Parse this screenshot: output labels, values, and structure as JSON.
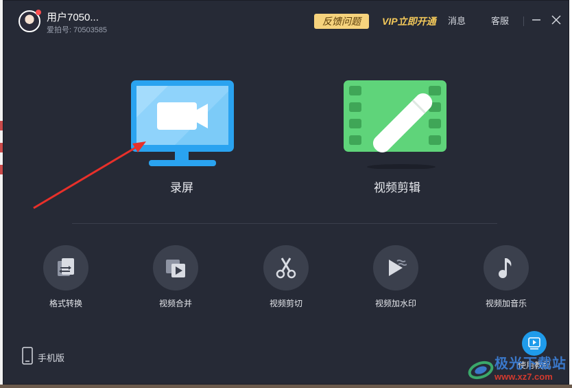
{
  "header": {
    "username": "用户7050...",
    "user_id": "爱拍号: 70503585",
    "feedback_label": "反馈问题",
    "vip_label": "VIP立即开通",
    "messages_label": "消息",
    "service_label": "客服"
  },
  "features": {
    "record_label": "录屏",
    "edit_label": "视频剪辑"
  },
  "tools": [
    {
      "label": "格式转换",
      "icon": "format-convert-icon"
    },
    {
      "label": "视频合并",
      "icon": "video-merge-icon"
    },
    {
      "label": "视频剪切",
      "icon": "scissors-icon"
    },
    {
      "label": "视频加水印",
      "icon": "watermark-icon"
    },
    {
      "label": "视频加音乐",
      "icon": "music-note-icon"
    }
  ],
  "footer": {
    "mobile_label": "手机版",
    "tutorial_label": "使用教程"
  },
  "watermark": {
    "title": "极光下载站",
    "url": "www.xz7.com"
  },
  "colors": {
    "background": "#262a36",
    "record_blue": "#2aa3f0",
    "edit_green": "#5fd47a",
    "feedback_bg": "#f6d37d",
    "vip_gold": "#f4c95a",
    "annotation_arrow": "#e8302a"
  }
}
